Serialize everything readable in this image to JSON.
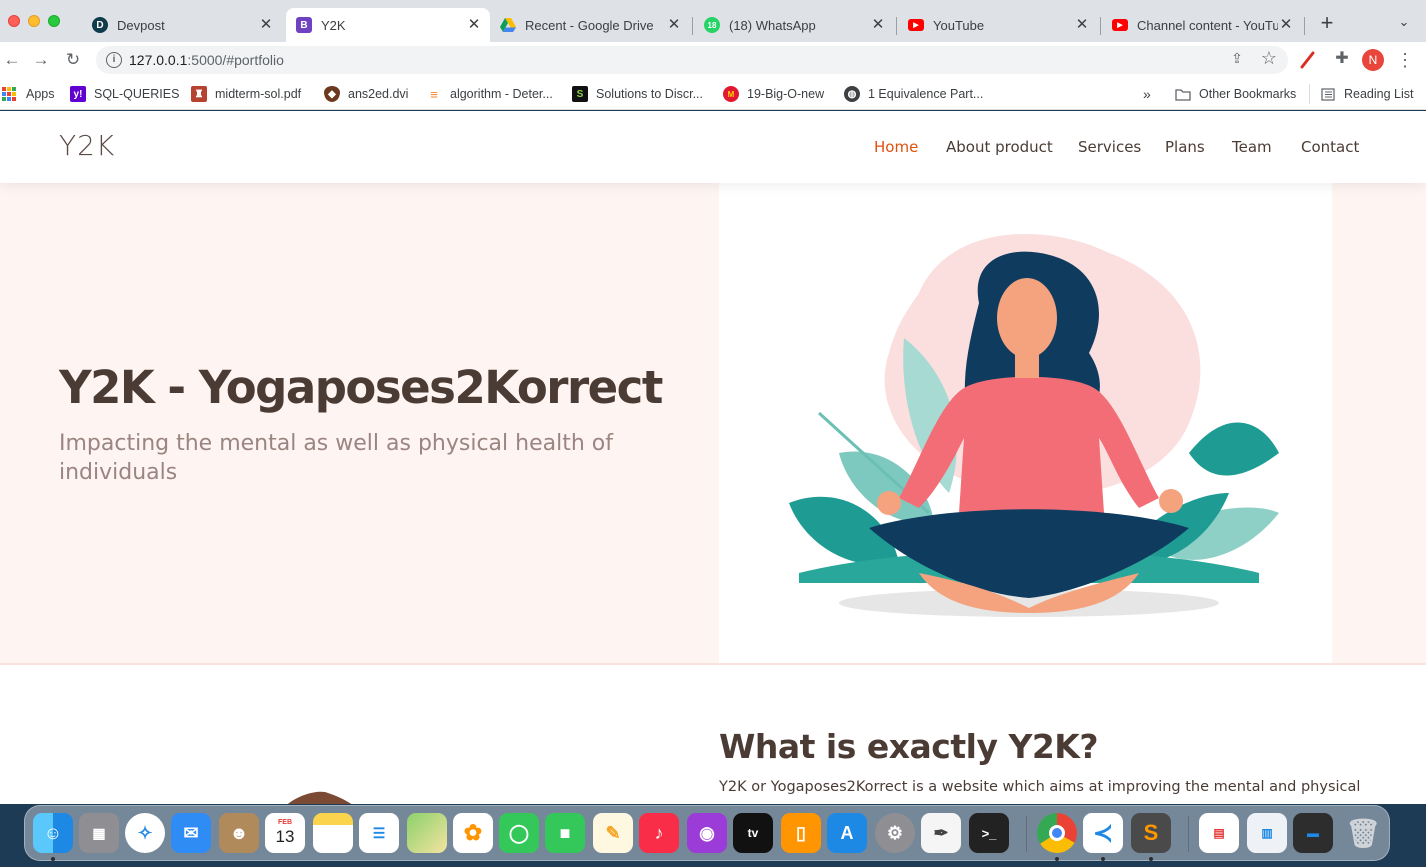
{
  "browser": {
    "tabs": [
      {
        "title": "Devpost",
        "icon": "devpost-icon",
        "active": false
      },
      {
        "title": "Y2K",
        "icon": "bootstrap-icon",
        "active": true
      },
      {
        "title": "Recent - Google Drive",
        "icon": "google-drive-icon",
        "active": false
      },
      {
        "title": "(18) WhatsApp",
        "icon": "whatsapp-icon",
        "active": false,
        "badge": "18"
      },
      {
        "title": "YouTube",
        "icon": "youtube-icon",
        "active": false
      },
      {
        "title": "Channel content - YouTube",
        "icon": "youtube-icon",
        "active": false
      }
    ],
    "url": {
      "host": "127.0.0.1",
      "rest": ":5000/#portfolio"
    },
    "profile_initial": "N",
    "bookmarks": [
      {
        "label": "Apps",
        "icon": "apps-grid-icon"
      },
      {
        "label": "SQL-QUERIES",
        "icon": "yahoo-icon"
      },
      {
        "label": "midterm-sol.pdf",
        "icon": "university-crest-icon"
      },
      {
        "label": "ans2ed.dvi",
        "icon": "shield-crest-icon"
      },
      {
        "label": "algorithm - Deter...",
        "icon": "stackoverflow-icon"
      },
      {
        "label": "Solutions to Discr...",
        "icon": "slader-icon"
      },
      {
        "label": "19-Big-O-new",
        "icon": "maryland-icon"
      },
      {
        "label": "1 Equivalence Part...",
        "icon": "globe-icon"
      }
    ],
    "bookmarks_more": "»",
    "other_bookmarks": "Other Bookmarks",
    "reading_list": "Reading List"
  },
  "site": {
    "logo": "Y2K",
    "nav": [
      {
        "label": "Home",
        "active": true
      },
      {
        "label": "About product",
        "active": false
      },
      {
        "label": "Services",
        "active": false
      },
      {
        "label": "Plans",
        "active": false
      },
      {
        "label": "Team",
        "active": false
      },
      {
        "label": "Contact",
        "active": false
      }
    ],
    "hero": {
      "title": "Y2K - Yogaposes2Korrect",
      "subtitle": "Impacting the mental as well as physical health of individuals"
    },
    "about": {
      "title": "What is exactly Y2K?",
      "text": "Y2K or Yogaposes2Korrect is a website which aims at improving the mental and physical"
    },
    "colors": {
      "accent": "#e0510d",
      "heading": "#4b3b35",
      "hero_bg": "#fef4f2"
    }
  },
  "dock": {
    "apps": [
      "finder",
      "launchpad",
      "safari",
      "mail",
      "contacts",
      "calendar",
      "notes",
      "reminders",
      "maps",
      "photos",
      "messages",
      "facetime",
      "freeform",
      "music",
      "podcasts",
      "apple-tv",
      "books",
      "app-store",
      "system-preferences",
      "textedit",
      "terminal",
      "chrome",
      "vscode",
      "sublime-text",
      "preview-doc",
      "screenshot-thumb",
      "terminal-window",
      "trash"
    ],
    "calendar": {
      "month": "FEB",
      "day": "13"
    }
  }
}
